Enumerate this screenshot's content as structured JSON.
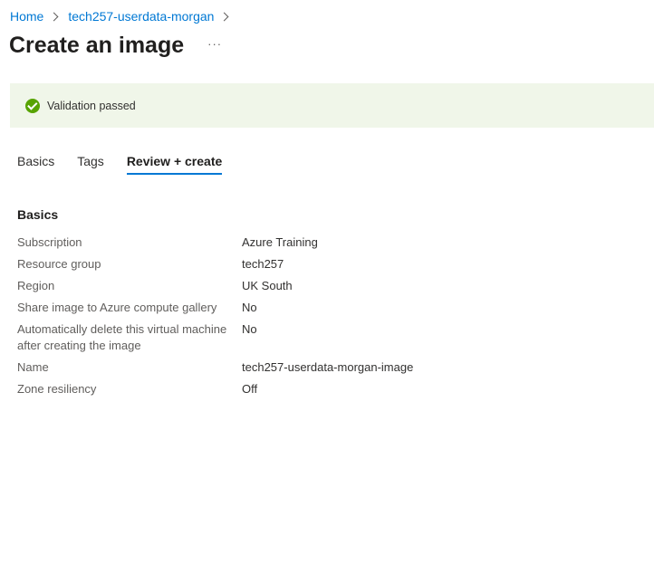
{
  "breadcrumb": {
    "items": [
      "Home",
      "tech257-userdata-morgan"
    ]
  },
  "header": {
    "title": "Create an image",
    "more_label": "···"
  },
  "banner": {
    "status": "success",
    "message": "Validation passed"
  },
  "tabs": [
    {
      "label": "Basics",
      "active": false
    },
    {
      "label": "Tags",
      "active": false
    },
    {
      "label": "Review + create",
      "active": true
    }
  ],
  "section": {
    "heading": "Basics",
    "rows": [
      {
        "label": "Subscription",
        "value": "Azure Training"
      },
      {
        "label": "Resource group",
        "value": "tech257"
      },
      {
        "label": "Region",
        "value": "UK South"
      },
      {
        "label": "Share image to Azure compute gallery",
        "value": "No"
      },
      {
        "label": "Automatically delete this virtual machine after creating the image",
        "value": "No"
      },
      {
        "label": "Name",
        "value": "tech257-userdata-morgan-image"
      },
      {
        "label": "Zone resiliency",
        "value": "Off"
      }
    ]
  },
  "colors": {
    "link": "#0078d4",
    "success": "#57a300",
    "banner_bg": "#f0f6e9"
  }
}
